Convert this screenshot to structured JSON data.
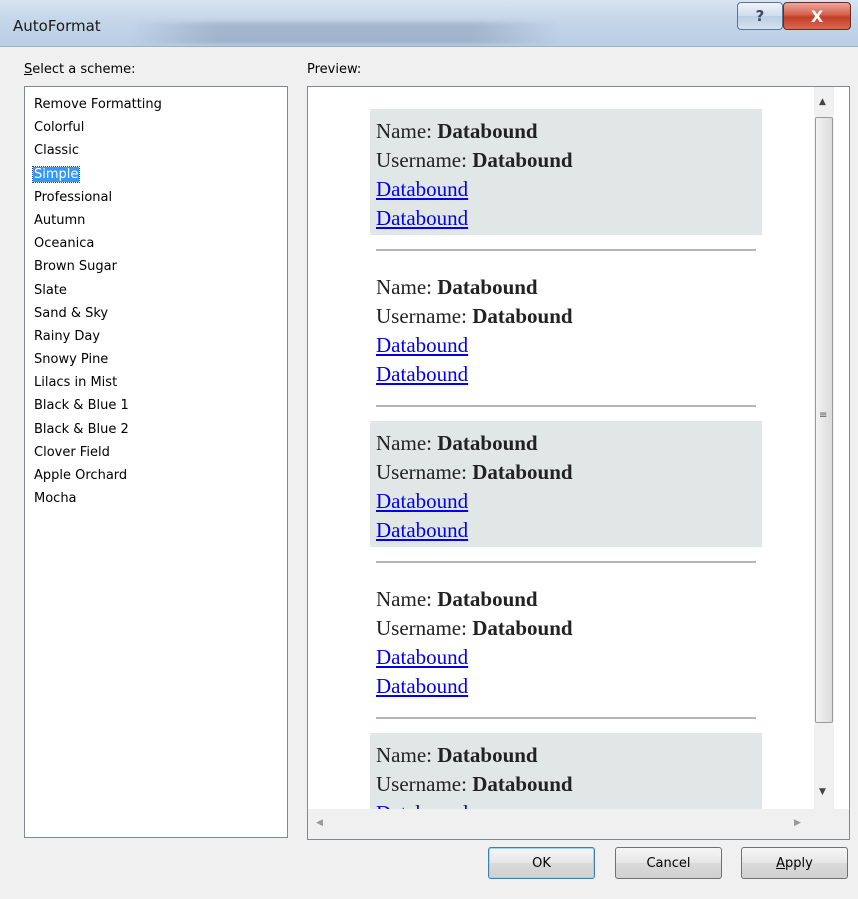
{
  "window": {
    "title": "AutoFormat",
    "help_label": "?",
    "close_label": "X"
  },
  "scheme": {
    "label_accel": "S",
    "label_rest": "elect a scheme:",
    "items": [
      "Remove Formatting",
      "Colorful",
      "Classic",
      "Simple",
      "Professional",
      "Autumn",
      "Oceanica",
      "Brown Sugar",
      "Slate",
      "Sand & Sky",
      "Rainy Day",
      "Snowy Pine",
      "Lilacs in Mist",
      "Black & Blue 1",
      "Black & Blue 2",
      "Clover Field",
      "Apple Orchard",
      "Mocha"
    ],
    "selected": "Simple"
  },
  "preview": {
    "label": "Preview:",
    "name_label": "Name: ",
    "username_label": "Username: ",
    "value": "Databound",
    "link": "Databound",
    "alt_row_color": "#e1e7e7",
    "link_color": "#0000ee"
  },
  "buttons": {
    "ok": "OK",
    "cancel": "Cancel",
    "apply_accel": "A",
    "apply_rest": "pply"
  },
  "scrollbar": {
    "up_arrow": "▲",
    "down_arrow": "▼",
    "left_arrow": "◀",
    "right_arrow": "▶",
    "grip": "≡"
  }
}
